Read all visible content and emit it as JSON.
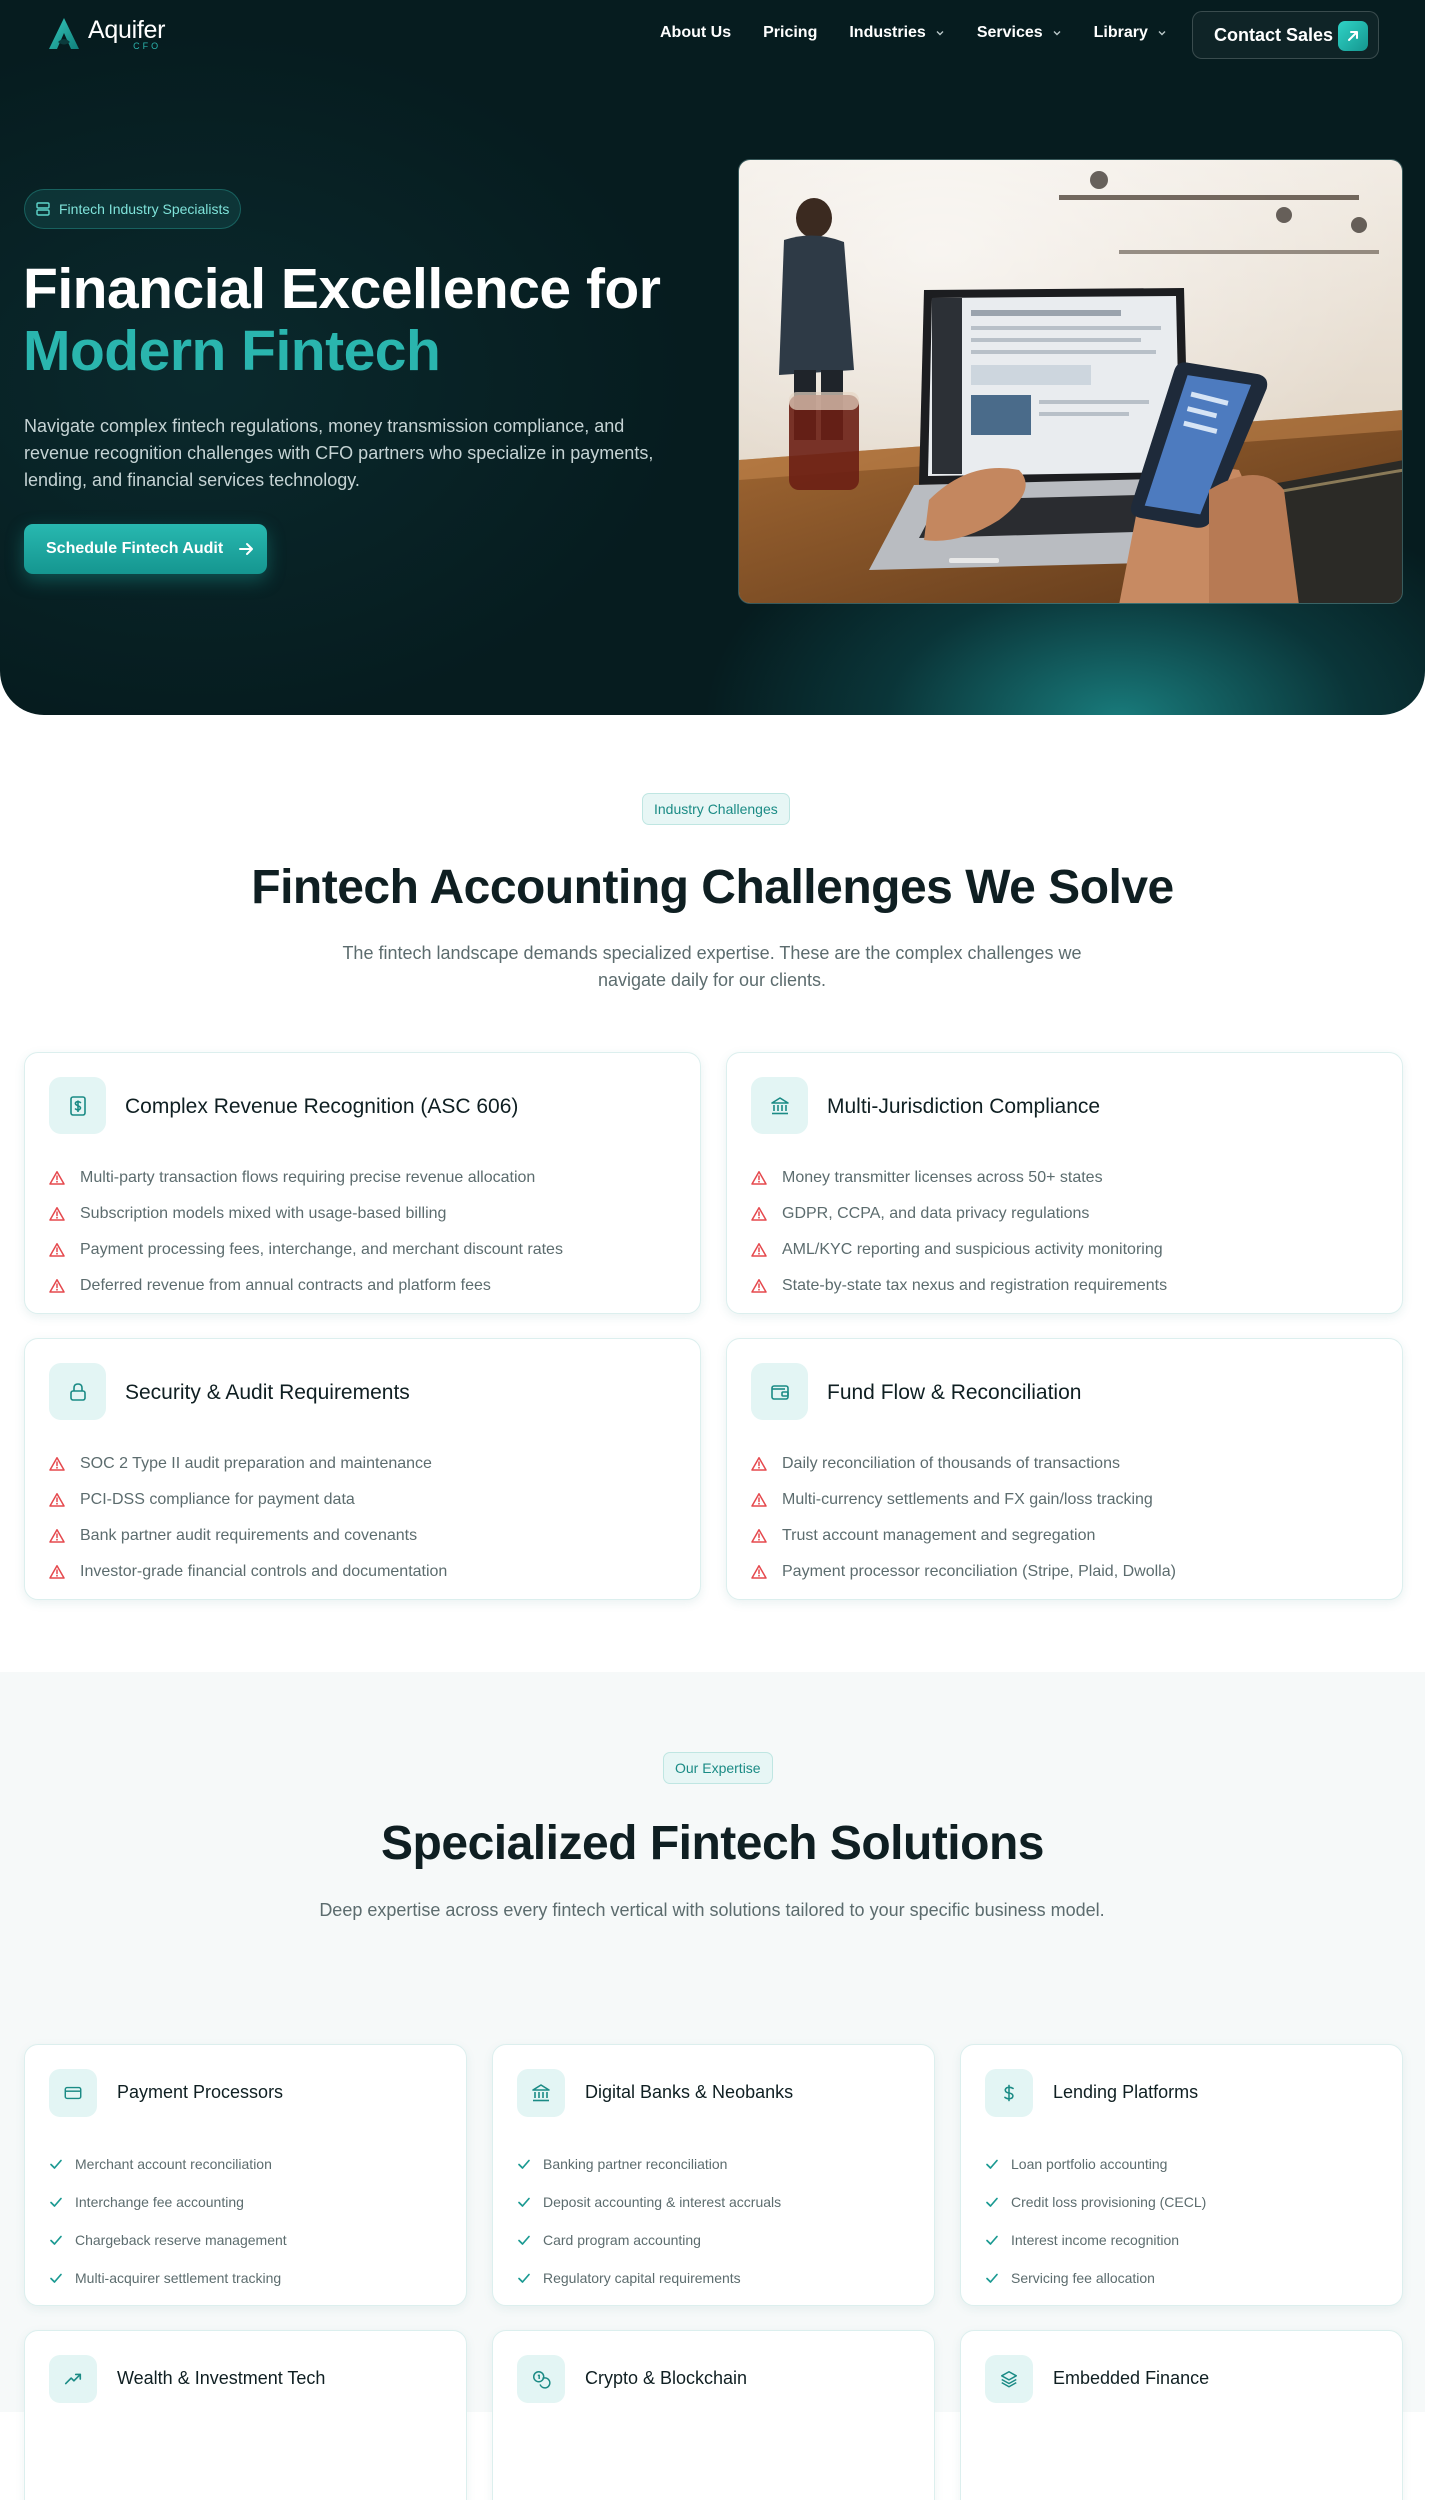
{
  "brand": {
    "name": "Aquifer",
    "sub": "CFO"
  },
  "nav": {
    "links": [
      {
        "label": "About Us",
        "dropdown": false
      },
      {
        "label": "Pricing",
        "dropdown": false
      },
      {
        "label": "Industries",
        "dropdown": true
      },
      {
        "label": "Services",
        "dropdown": true
      },
      {
        "label": "Library",
        "dropdown": true
      }
    ],
    "contact_label": "Contact Sales"
  },
  "hero": {
    "badge": "Fintech Industry Specialists",
    "title_line1": "Financial Excellence for",
    "title_line2": "Modern Fintech",
    "description": "Navigate complex fintech regulations, money transmission compliance, and revenue recognition challenges with CFO partners who specialize in payments, lending, and financial services technology.",
    "cta_label": "Schedule Fintech Audit"
  },
  "challenges": {
    "pill": "Industry Challenges",
    "title": "Fintech Accounting Challenges We Solve",
    "description": "The fintech landscape demands specialized expertise. These are the complex challenges we navigate daily for our clients.",
    "cards": [
      {
        "icon": "dollar-document-icon",
        "title": "Complex Revenue Recognition (ASC 606)",
        "items": [
          "Multi-party transaction flows requiring precise revenue allocation",
          "Subscription models mixed with usage-based billing",
          "Payment processing fees, interchange, and merchant discount rates",
          "Deferred revenue from annual contracts and platform fees"
        ]
      },
      {
        "icon": "bank-icon",
        "title": "Multi-Jurisdiction Compliance",
        "items": [
          "Money transmitter licenses across 50+ states",
          "GDPR, CCPA, and data privacy regulations",
          "AML/KYC reporting and suspicious activity monitoring",
          "State-by-state tax nexus and registration requirements"
        ]
      },
      {
        "icon": "lock-icon",
        "title": "Security & Audit Requirements",
        "items": [
          "SOC 2 Type II audit preparation and maintenance",
          "PCI-DSS compliance for payment data",
          "Bank partner audit requirements and covenants",
          "Investor-grade financial controls and documentation"
        ]
      },
      {
        "icon": "wallet-icon",
        "title": "Fund Flow & Reconciliation",
        "items": [
          "Daily reconciliation of thousands of transactions",
          "Multi-currency settlements and FX gain/loss tracking",
          "Trust account management and segregation",
          "Payment processor reconciliation (Stripe, Plaid, Dwolla)"
        ]
      }
    ]
  },
  "solutions": {
    "pill": "Our Expertise",
    "title": "Specialized Fintech Solutions",
    "description": "Deep expertise across every fintech vertical with solutions tailored to your specific business model.",
    "cards": [
      {
        "icon": "credit-card-icon",
        "title": "Payment Processors",
        "items": [
          "Merchant account reconciliation",
          "Interchange fee accounting",
          "Chargeback reserve management",
          "Multi-acquirer settlement tracking"
        ]
      },
      {
        "icon": "bank-icon",
        "title": "Digital Banks & Neobanks",
        "items": [
          "Banking partner reconciliation",
          "Deposit accounting & interest accruals",
          "Card program accounting",
          "Regulatory capital requirements"
        ]
      },
      {
        "icon": "dollar-icon",
        "title": "Lending Platforms",
        "items": [
          "Loan portfolio accounting",
          "Credit loss provisioning (CECL)",
          "Interest income recognition",
          "Servicing fee allocation"
        ]
      },
      {
        "icon": "trending-up-icon",
        "title": "Wealth & Investment Tech",
        "items": []
      },
      {
        "icon": "coins-icon",
        "title": "Crypto & Blockchain",
        "items": []
      },
      {
        "icon": "layers-icon",
        "title": "Embedded Finance",
        "items": []
      }
    ]
  },
  "colors": {
    "accent": "#2ab5ae",
    "hero_bg": "#061c1f",
    "warning": "#e5484d",
    "check": "#1b9a92"
  }
}
